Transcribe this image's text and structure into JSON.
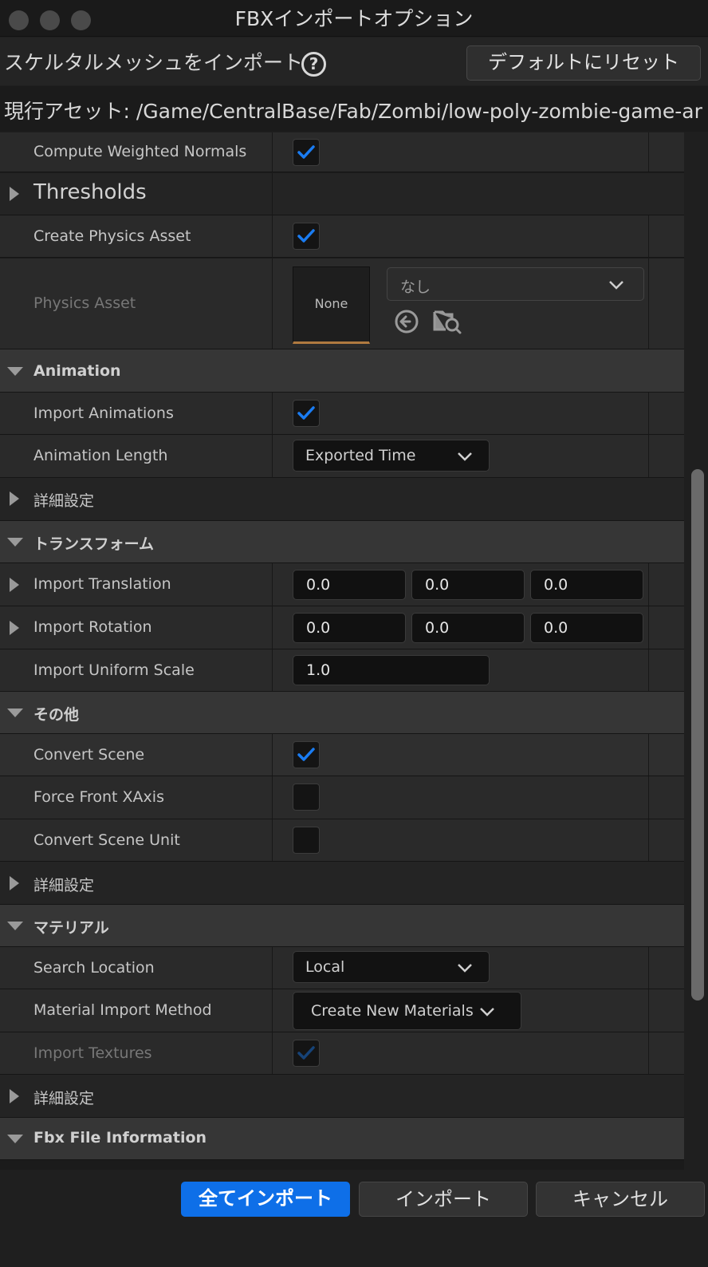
{
  "window": {
    "title": "FBXインポートオプション"
  },
  "header": {
    "title": "スケルタルメッシュをインポート",
    "help_icon": "question-circle-icon",
    "reset_label": "デフォルトにリセット"
  },
  "current_asset": {
    "text": "現行アセット:  /Game/CentralBase/Fab/Zombi/low-poly-zombie-game-ar"
  },
  "rows": {
    "compute_weighted_normals": {
      "label": "Compute Weighted Normals",
      "checked": true
    },
    "thresholds": {
      "label": "Thresholds"
    },
    "create_physics_asset": {
      "label": "Create Physics Asset",
      "checked": true
    },
    "physics_asset": {
      "label": "Physics Asset",
      "thumbnail_text": "None",
      "combo_value": "なし",
      "browse_icon": "arrow-left-circle-icon",
      "find_icon": "folder-search-icon"
    },
    "animation": {
      "label": "Animation"
    },
    "import_animations": {
      "label": "Import Animations",
      "checked": true
    },
    "animation_length": {
      "label": "Animation Length",
      "value": "Exported Time"
    },
    "advanced_1": {
      "label": "詳細設定"
    },
    "transform": {
      "label": "トランスフォーム"
    },
    "import_translation": {
      "label": "Import Translation",
      "x": "0.0",
      "y": "0.0",
      "z": "0.0"
    },
    "import_rotation": {
      "label": "Import Rotation",
      "x": "0.0",
      "y": "0.0",
      "z": "0.0"
    },
    "import_uniform_scale": {
      "label": "Import Uniform Scale",
      "value": "1.0"
    },
    "misc": {
      "label": "その他"
    },
    "convert_scene": {
      "label": "Convert Scene",
      "checked": true
    },
    "force_front_xaxis": {
      "label": "Force Front XAxis",
      "checked": false
    },
    "convert_scene_unit": {
      "label": "Convert Scene Unit",
      "checked": false
    },
    "advanced_2": {
      "label": "詳細設定"
    },
    "material": {
      "label": "マテリアル"
    },
    "search_location": {
      "label": "Search Location",
      "value": "Local"
    },
    "material_import_method": {
      "label": "Material Import Method",
      "value": "Create New Materials"
    },
    "import_textures": {
      "label": "Import Textures",
      "checked": true
    },
    "advanced_3": {
      "label": "詳細設定"
    },
    "fbx_file_information": {
      "label": "Fbx File Information"
    }
  },
  "footer": {
    "import_all_label": "全てインポート",
    "import_label": "インポート",
    "cancel_label": "キャンセル"
  },
  "colors": {
    "accent": "#0e6fe8",
    "check": "#1a7cf2",
    "panel": "#2a2a2a",
    "category": "#363636"
  }
}
